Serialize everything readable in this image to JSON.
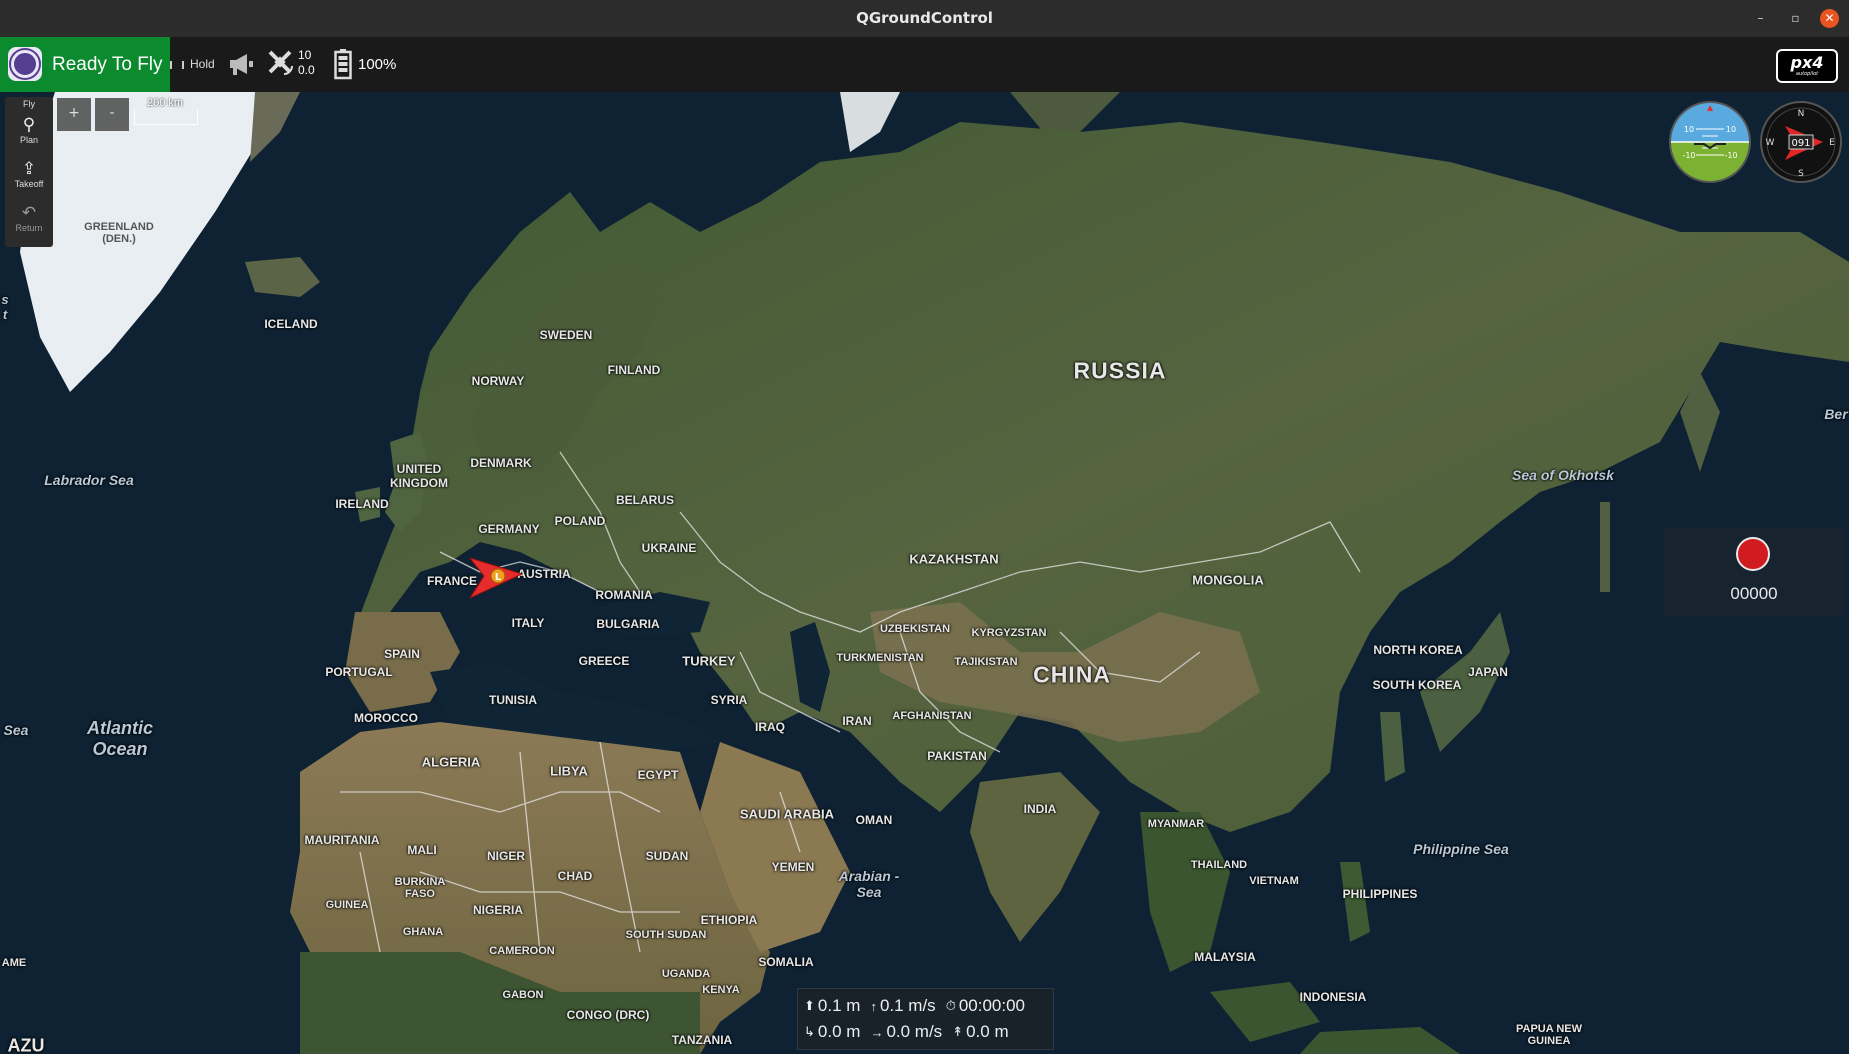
{
  "window": {
    "title": "QGroundControl",
    "min_icon": "minimize-icon",
    "max_icon": "maximize-icon",
    "close_icon": "close-icon"
  },
  "toolbar": {
    "status": "Ready To Fly",
    "flight_mode": "Hold",
    "gps_satellites": "10",
    "gps_hdop": "0.0",
    "battery": "100%",
    "colors": {
      "status_bg": "#0c8a2e",
      "toolbar_bg": "#1a1a1a"
    },
    "logo_text": "px4",
    "logo_subtext": "autopilot"
  },
  "toolstrip": {
    "items": [
      {
        "label": "Fly",
        "icon": "fly-icon"
      },
      {
        "label": "Plan",
        "icon": "plan-icon"
      },
      {
        "label": "Takeoff",
        "icon": "takeoff-icon"
      },
      {
        "label": "Return",
        "icon": "return-icon"
      }
    ]
  },
  "map": {
    "zoom_in": "+",
    "zoom_out": "-",
    "scale": "200 km",
    "labels": {
      "greenland": "GREENLAND (DEN.)",
      "iceland": "ICELAND",
      "sweden": "SWEDEN",
      "finland": "FINLAND",
      "norway": "NORWAY",
      "russia": "RUSSIA",
      "labrador_sea": "Labrador Sea",
      "united_kingdom": "UNITED KINGDOM",
      "ireland": "IRELAND",
      "denmark": "DENMARK",
      "germany": "GERMANY",
      "poland": "POLAND",
      "belarus": "BELARUS",
      "ukraine": "UKRAINE",
      "france": "FRANCE",
      "austria": "AUSTRIA",
      "romania": "ROMANIA",
      "italy": "ITALY",
      "bulgaria": "BULGARIA",
      "spain": "SPAIN",
      "portugal": "PORTUGAL",
      "greece": "GREECE",
      "turkey": "TURKEY",
      "kazakhstan": "KAZAKHSTAN",
      "mongolia": "MONGOLIA",
      "uzbekistan": "UZBEKISTAN",
      "kyrgyzstan": "KYRGYZSTAN",
      "turkmenistan": "TURKMENISTAN",
      "tajikistan": "TAJIKISTAN",
      "china": "CHINA",
      "north_korea": "NORTH KOREA",
      "south_korea": "SOUTH KOREA",
      "japan": "JAPAN",
      "sea_of_okhotsk": "Sea of Okhotsk",
      "bering": "Ber",
      "morocco": "MOROCCO",
      "tunisia": "TUNISIA",
      "syria": "SYRIA",
      "iraq": "IRAQ",
      "iran": "IRAN",
      "afghanistan": "AFGHANISTAN",
      "pakistan": "PAKISTAN",
      "india": "INDIA",
      "algeria": "ALGERIA",
      "libya": "LIBYA",
      "egypt": "EGYPT",
      "saudi_arabia": "SAUDI ARABIA",
      "oman": "OMAN",
      "yemen": "YEMEN",
      "arabian_sea": "Arabian - Sea",
      "atlantic": "Atlantic Ocean",
      "sea_left": "Sea",
      "mauritania": "MAURITANIA",
      "mali": "MALI",
      "niger": "NIGER",
      "chad": "CHAD",
      "sudan": "SUDAN",
      "burkina_faso": "BURKINA FASO",
      "guinea": "GUINEA",
      "ghana": "GHANA",
      "nigeria": "NIGERIA",
      "cameroon": "CAMEROON",
      "ethiopia": "ETHIOPIA",
      "south_sudan": "SOUTH SUDAN",
      "somalia": "SOMALIA",
      "uganda": "UGANDA",
      "kenya": "KENYA",
      "gabon": "GABON",
      "congo": "CONGO (DRC)",
      "tanzania": "TANZANIA",
      "myanmar": "MYANMAR",
      "thailand": "THAILAND",
      "vietnam": "VIETNAM",
      "philippines": "PHILIPPINES",
      "philippine_sea": "Philippine Sea",
      "malaysia": "MALAYSIA",
      "indonesia": "INDONESIA",
      "papua": "PAPUA NEW GUINEA",
      "ame": "AME",
      "azu": "AZU",
      "left_edge": "s t"
    },
    "vehicle_marker": "L"
  },
  "instruments": {
    "attitude_ticks": [
      "10",
      "10",
      "-10",
      "-10"
    ],
    "compass_heading": "091",
    "compass_n": "N",
    "compass_e": "E",
    "compass_s": "S",
    "compass_w": "W"
  },
  "record": {
    "count": "00000",
    "color": "#e81a20"
  },
  "telemetry": {
    "altitude": "0.1 m",
    "climb_rate": "0.1 m/s",
    "flight_time": "00:00:00",
    "distance": "0.0 m",
    "ground_speed": "0.0 m/s",
    "home_distance": "0.0 m"
  }
}
